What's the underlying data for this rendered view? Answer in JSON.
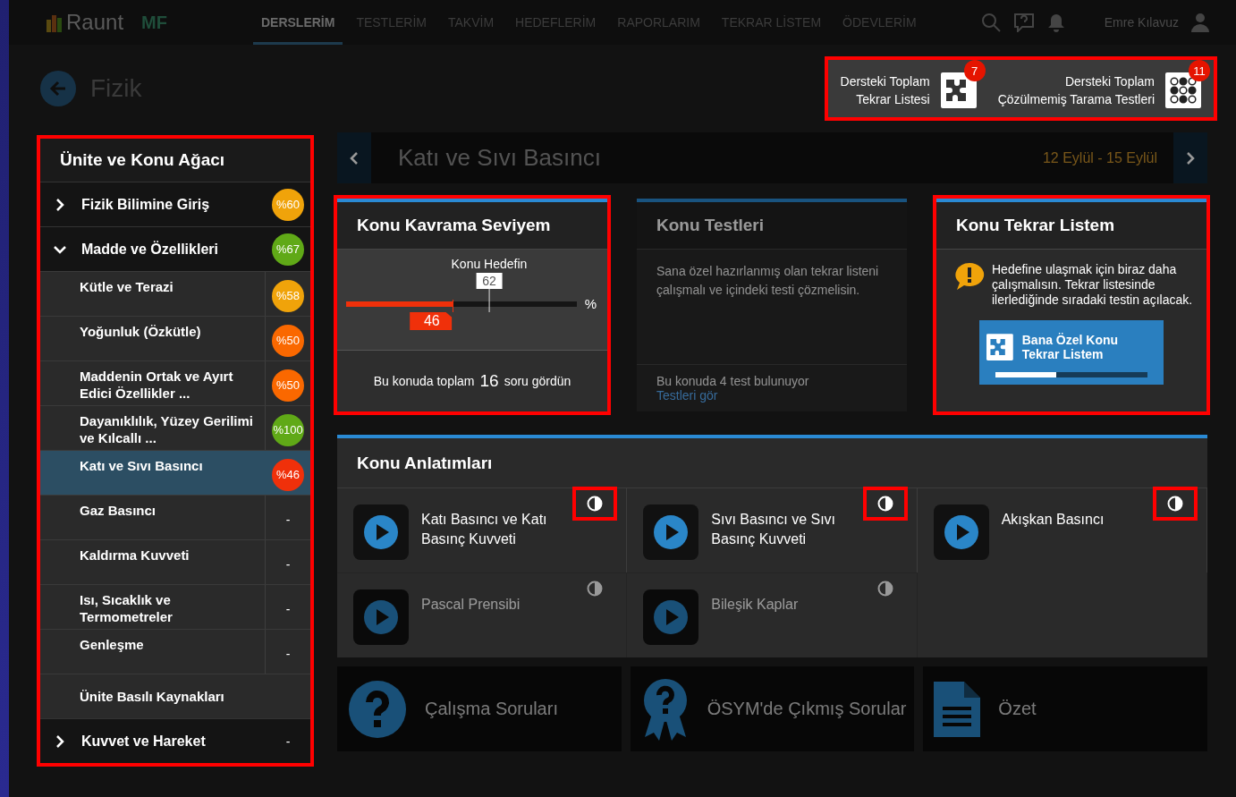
{
  "nav": {
    "logo": "Raunt",
    "badge": "MF",
    "items": [
      {
        "label": "DERSLERİM",
        "selected": true
      },
      {
        "label": "TESTLERİM",
        "selected": false
      },
      {
        "label": "TAKVİM",
        "selected": false
      },
      {
        "label": "HEDEFLERİM",
        "selected": false
      },
      {
        "label": "RAPORLARIM",
        "selected": false
      },
      {
        "label": "TEKRAR LİSTEM",
        "selected": false
      },
      {
        "label": "ÖDEVLERİM",
        "selected": false
      }
    ],
    "user": "Emre Kılavuz"
  },
  "page": {
    "title": "Fizik"
  },
  "stats": {
    "highlighted": true,
    "items": [
      {
        "kind": "puzzle",
        "line1": "Dersteki Toplam",
        "line2": "Tekrar Listesi",
        "count": "7"
      },
      {
        "kind": "grid",
        "line1": "Dersteki Toplam",
        "line2": "Çözülmemiş Tarama Testleri",
        "count": "11"
      }
    ]
  },
  "sidebar": {
    "highlighted": true,
    "title": "Ünite ve Konu Ağacı",
    "units": [
      {
        "label": "Fizik Bilimine Giriş",
        "expanded": false,
        "score": "%60",
        "color": "#f0a30a"
      },
      {
        "label": "Madde ve Özellikleri",
        "expanded": true,
        "score": "%67",
        "color": "#60a917",
        "children": [
          {
            "kind": "topic",
            "label": "Kütle ve Terazi",
            "score": "%58",
            "color": "#f0a30a",
            "selected": false
          },
          {
            "kind": "topic",
            "label": "Yoğunluk (Özkütle)",
            "score": "%50",
            "color": "#fa6800",
            "selected": false
          },
          {
            "kind": "topic",
            "label": "Maddenin Ortak ve Ayırt Edici Özellikler ...",
            "score": "%50",
            "color": "#fa6800",
            "selected": false
          },
          {
            "kind": "topic",
            "label": "Dayanıklılık, Yüzey Gerilimi ve Kılcallı ...",
            "score": "%100",
            "color": "#60a917",
            "selected": false
          },
          {
            "kind": "topic",
            "label": "Katı ve Sıvı Basıncı",
            "score": "%46",
            "color": "#f0300a",
            "selected": true
          },
          {
            "kind": "topic",
            "label": "Gaz Basıncı",
            "score": "-",
            "selected": false
          },
          {
            "kind": "topic",
            "label": "Kaldırma Kuvveti",
            "score": "-",
            "selected": false
          },
          {
            "kind": "topic",
            "label": "Isı, Sıcaklık ve Termometreler",
            "score": "-",
            "selected": false
          },
          {
            "kind": "topic",
            "label": "Genleşme",
            "score": "-",
            "selected": false
          },
          {
            "kind": "resource",
            "label": "Ünite Basılı Kaynakları",
            "selected": false
          }
        ]
      },
      {
        "label": "Kuvvet ve Hareket",
        "expanded": false,
        "score": "-"
      }
    ]
  },
  "topic": {
    "title": "Katı ve Sıvı Basıncı",
    "dates": "12 Eylül - 15 Eylül"
  },
  "comprehension": {
    "highlighted": true,
    "title": "Konu Kavrama Seviyem",
    "target_label": "Konu Hedefin",
    "target": {
      "label": "62",
      "level": 0.62
    },
    "level": 0.46,
    "value": "46",
    "unit": "%",
    "seen_prefix": "Bu konuda toplam",
    "seen_count": "16",
    "seen_suffix": "soru gördün"
  },
  "tests": {
    "highlighted": false,
    "title": "Konu Testleri",
    "text": "Sana özel hazırlanmış olan tekrar listeni çalışmalı ve içindeki testi çözmelisin.",
    "count_text": "Bu konuda 4 test bulunuyor",
    "link": "Testleri gör"
  },
  "review": {
    "highlighted": true,
    "title": "Konu Tekrar Listem",
    "message": "Hedefine ulaşmak için biraz daha çalışmalısın. Tekrar listesinde ilerlediğinde sıradaki testin açılacak.",
    "button": "Bana Özel Konu Tekrar Listem",
    "level": 0.4
  },
  "lectures": {
    "title": "Konu Anlatımları",
    "items": [
      {
        "title": "Katı Basıncı ve Katı Basınç Kuvveti",
        "dimmed": false,
        "toggle_highlighted": true
      },
      {
        "title": "Sıvı Basıncı ve Sıvı Basınç Kuvveti",
        "dimmed": false,
        "toggle_highlighted": true
      },
      {
        "title": "Akışkan Basıncı",
        "dimmed": false,
        "toggle_highlighted": true
      },
      {
        "title": "Pascal Prensibi",
        "dimmed": true,
        "toggle_highlighted": false
      },
      {
        "title": "Bileşik Kaplar",
        "dimmed": true,
        "toggle_highlighted": false
      }
    ]
  },
  "resources": [
    {
      "kind": "questions",
      "label": "Çalışma Soruları"
    },
    {
      "kind": "exam",
      "label": "ÖSYM'de Çıkmış Sorular"
    },
    {
      "kind": "summary",
      "label": "Özet"
    }
  ]
}
